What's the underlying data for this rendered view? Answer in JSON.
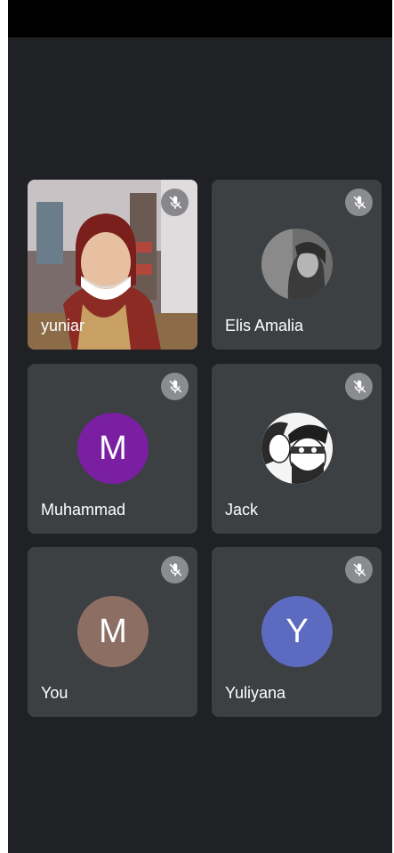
{
  "participants": [
    {
      "name": "yuniar",
      "muted": true,
      "media": "camera-video"
    },
    {
      "name": "Elis Amalia",
      "muted": true,
      "media": "profile-photo"
    },
    {
      "name": "Muhammad",
      "muted": true,
      "initial": "M",
      "color": "#7b1fa2"
    },
    {
      "name": "Jack",
      "muted": true,
      "media": "manga-profile-photo"
    },
    {
      "name": "You",
      "muted": true,
      "initial": "M",
      "color": "#8d6e63"
    },
    {
      "name": "Yuliyana",
      "muted": true,
      "initial": "Y",
      "color": "#5c6bc0"
    }
  ],
  "colors": {
    "background": "#202124",
    "tile": "#3c4043",
    "status_bar": "#000000",
    "mute_badge": "#8a8c8f",
    "text": "#ffffff"
  },
  "icons": {
    "mute": "mic-off-icon"
  }
}
